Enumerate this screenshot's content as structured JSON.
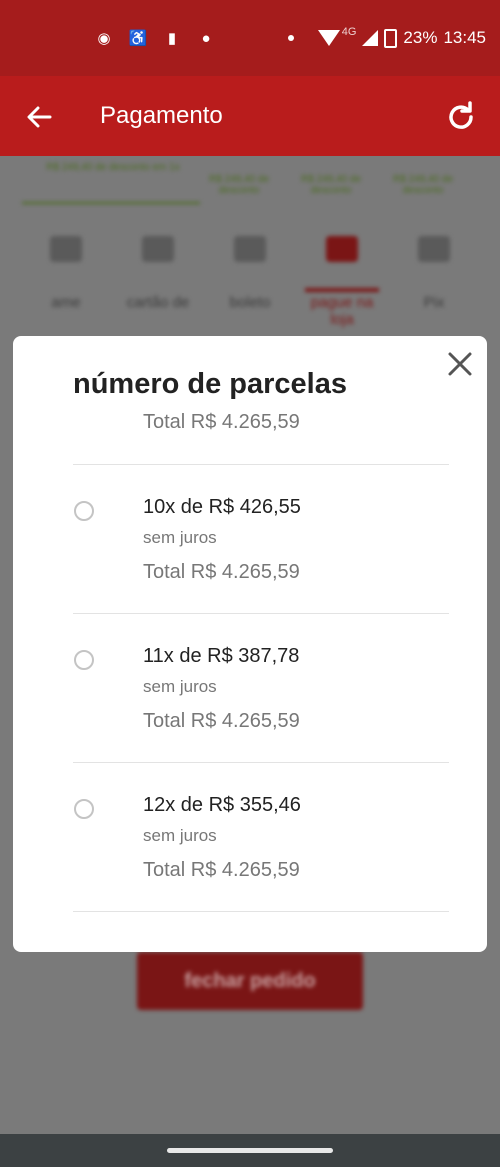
{
  "status_bar": {
    "time": "13:45",
    "battery": "23%",
    "network": "4G",
    "left_icons": [
      "ublock-icon",
      "accessibility-icon",
      "battery-saver-icon",
      "chat-icon"
    ]
  },
  "header": {
    "title": "Pagamento"
  },
  "background": {
    "promos": [
      "R$ 249,40 de desconto em 1x",
      "R$ 249,40 de desconto",
      "R$ 249,40 de desconto",
      "R$ 249,40 de desconto"
    ],
    "payment_methods": [
      "ame",
      "cartão de",
      "boleto",
      "pague na loja",
      "Pix"
    ],
    "close_order_button": "fechar pedido"
  },
  "modal": {
    "title": "número de parcelas",
    "total": "Total R$ 4.265,59",
    "options": [
      {
        "installments": "10x de R$ 426,55",
        "interest": "sem juros",
        "total": "Total R$ 4.265,59"
      },
      {
        "installments": "11x de R$ 387,78",
        "interest": "sem juros",
        "total": "Total R$ 4.265,59"
      },
      {
        "installments": "12x de R$ 355,46",
        "interest": "sem juros",
        "total": "Total R$ 4.265,59"
      }
    ]
  },
  "colors": {
    "header": "#b91c1c",
    "status_bar": "#a51c1c",
    "accent": "#7a1515"
  }
}
